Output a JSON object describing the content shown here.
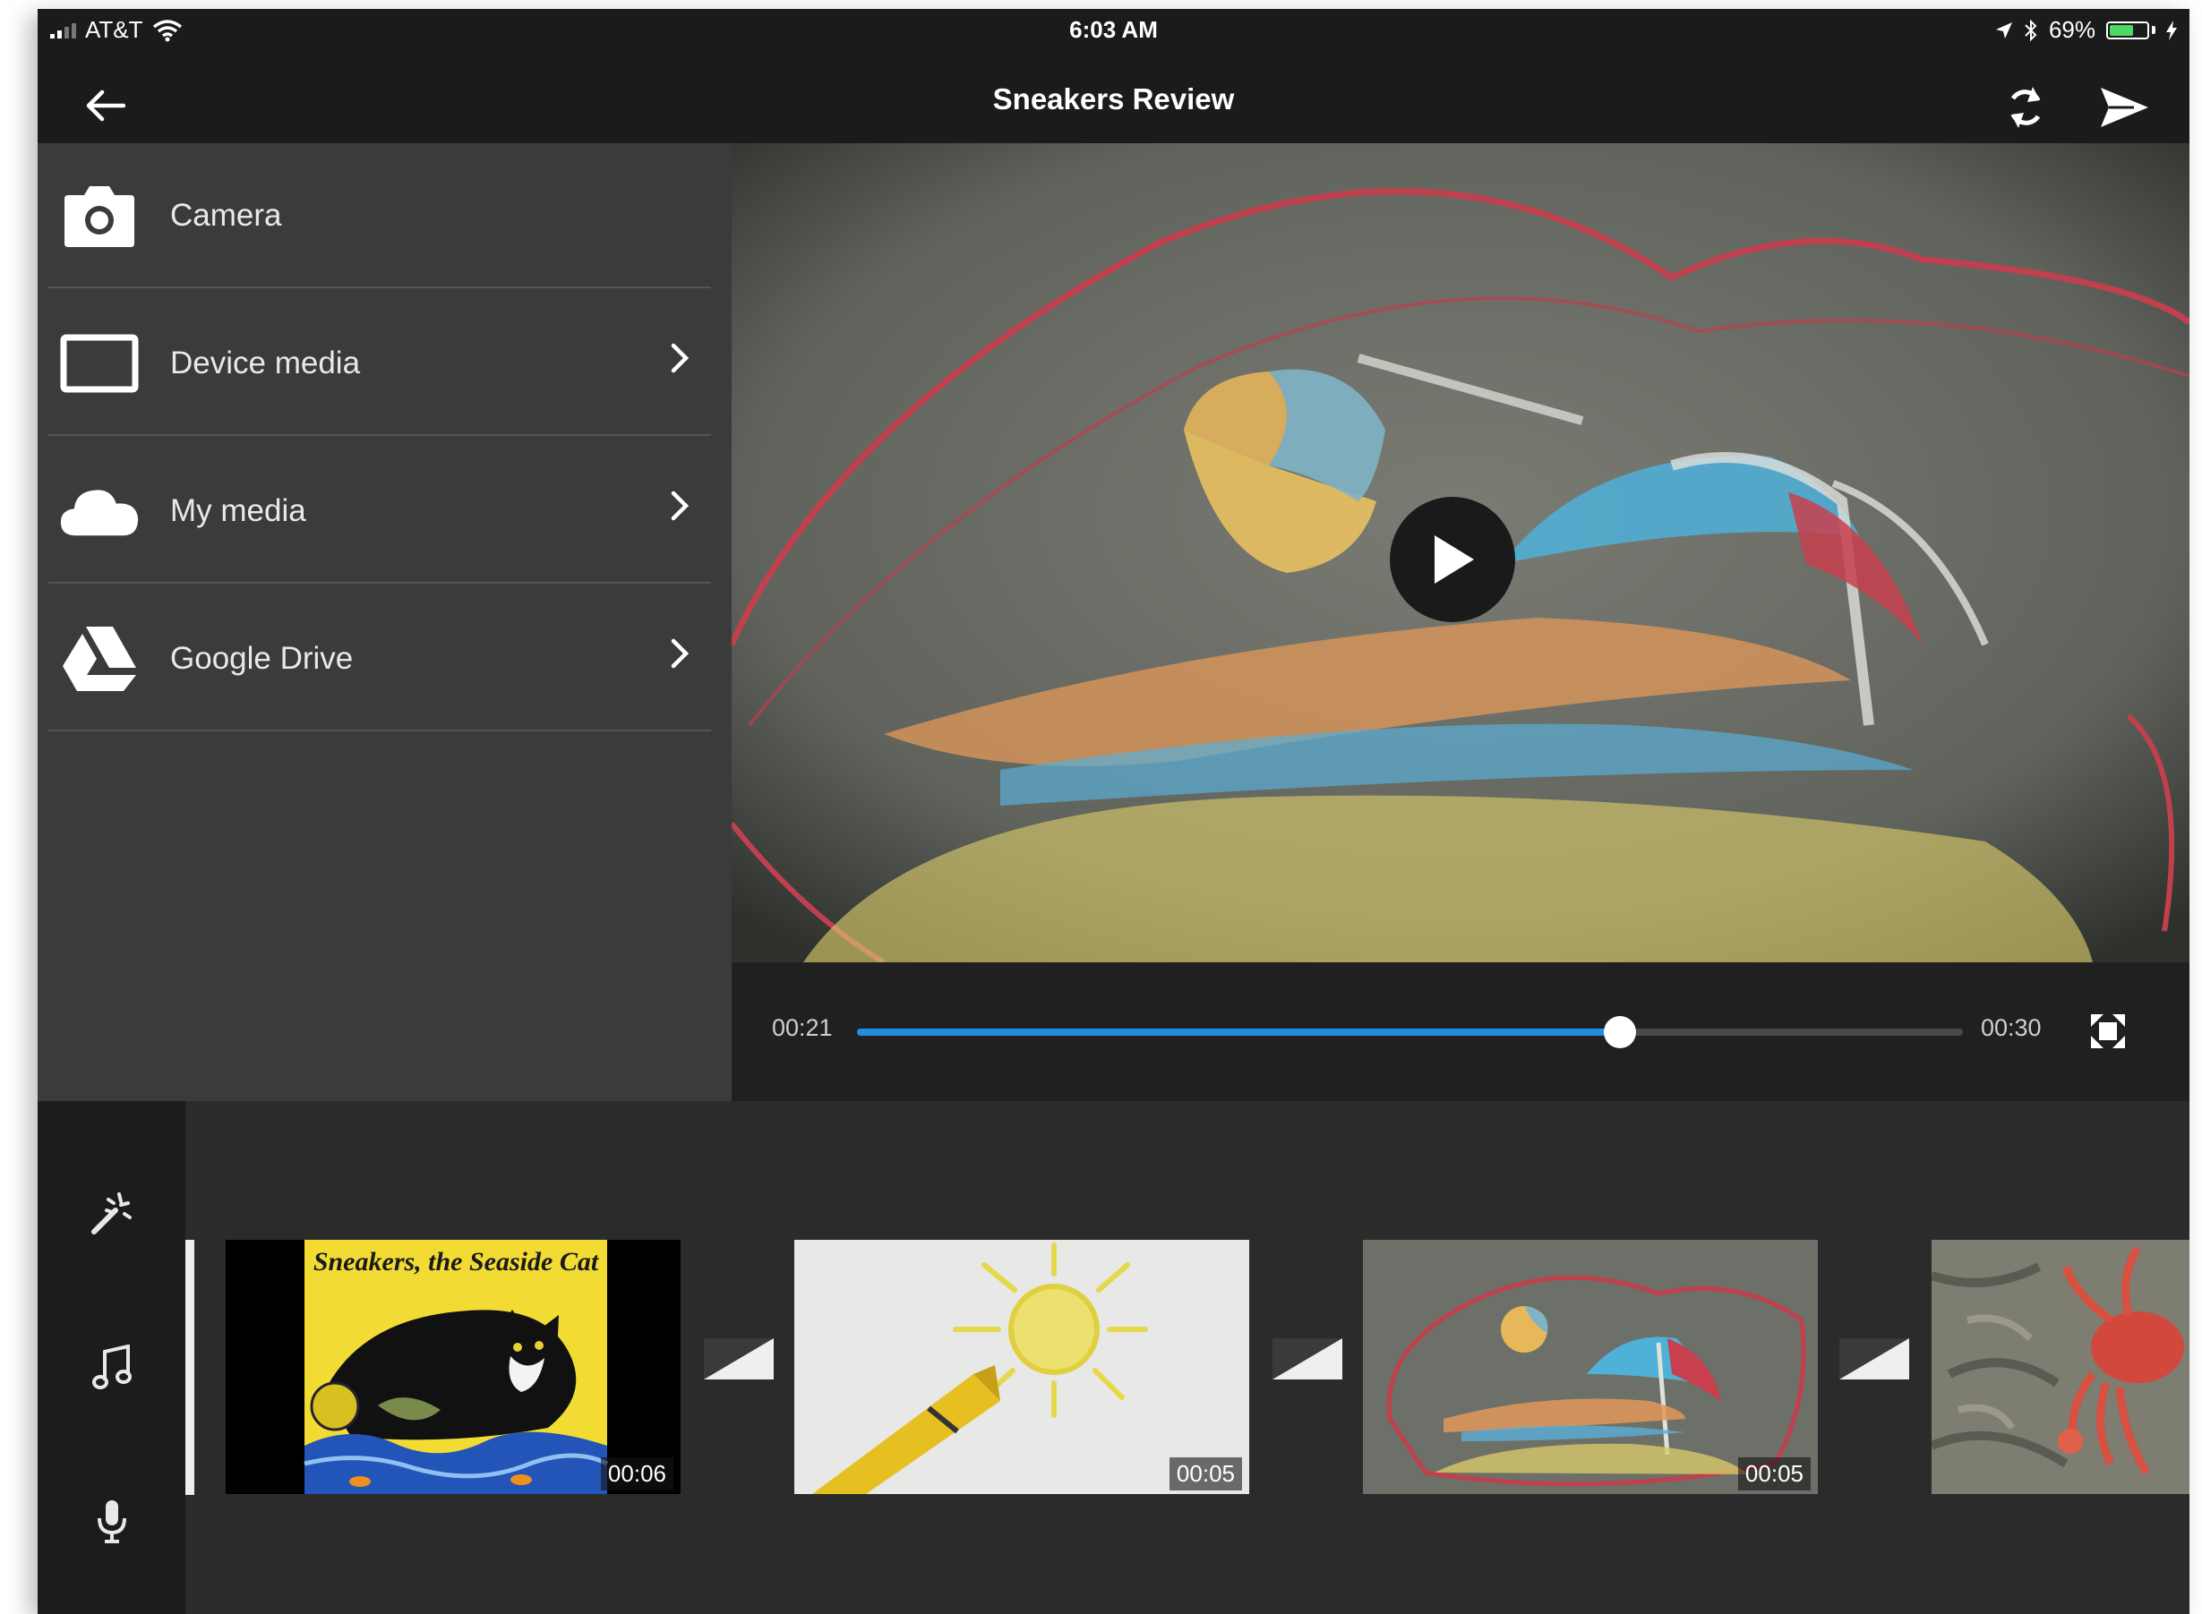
{
  "status_bar": {
    "carrier": "AT&T",
    "time": "6:03 AM",
    "battery_percent": "69%",
    "battery_level": 0.69,
    "icons": [
      "signal-bars-icon",
      "wifi-icon",
      "location-arrow-icon",
      "bluetooth-icon",
      "battery-icon",
      "charging-bolt-icon"
    ]
  },
  "header": {
    "title": "Sneakers Review",
    "icons": [
      "back-arrow-icon",
      "sync-icon",
      "send-icon"
    ]
  },
  "media_sources": [
    {
      "label": "Camera",
      "icon": "camera-icon",
      "has_chevron": false
    },
    {
      "label": "Device media",
      "icon": "device-media-icon",
      "has_chevron": true
    },
    {
      "label": "My media",
      "icon": "cloud-icon",
      "has_chevron": true
    },
    {
      "label": "Google Drive",
      "icon": "google-drive-icon",
      "has_chevron": true
    }
  ],
  "player": {
    "current_time": "00:21",
    "total_time": "00:30",
    "progress": 0.69,
    "accent_color": "#1f8ee0",
    "icons": [
      "play-icon",
      "fullscreen-icon"
    ]
  },
  "timeline": {
    "tools": [
      "magic-wand-icon",
      "music-note-icon",
      "microphone-icon"
    ],
    "clips": [
      {
        "name": "book-cover-clip",
        "duration": "00:06",
        "cover_title": "Sneakers, the Seaside Cat"
      },
      {
        "name": "crayon-sun-clip",
        "duration": "00:05"
      },
      {
        "name": "chalk-beach-clip",
        "duration": "00:05"
      },
      {
        "name": "crab-clip"
      }
    ],
    "transition_icon": "crossfade-transition-icon"
  }
}
